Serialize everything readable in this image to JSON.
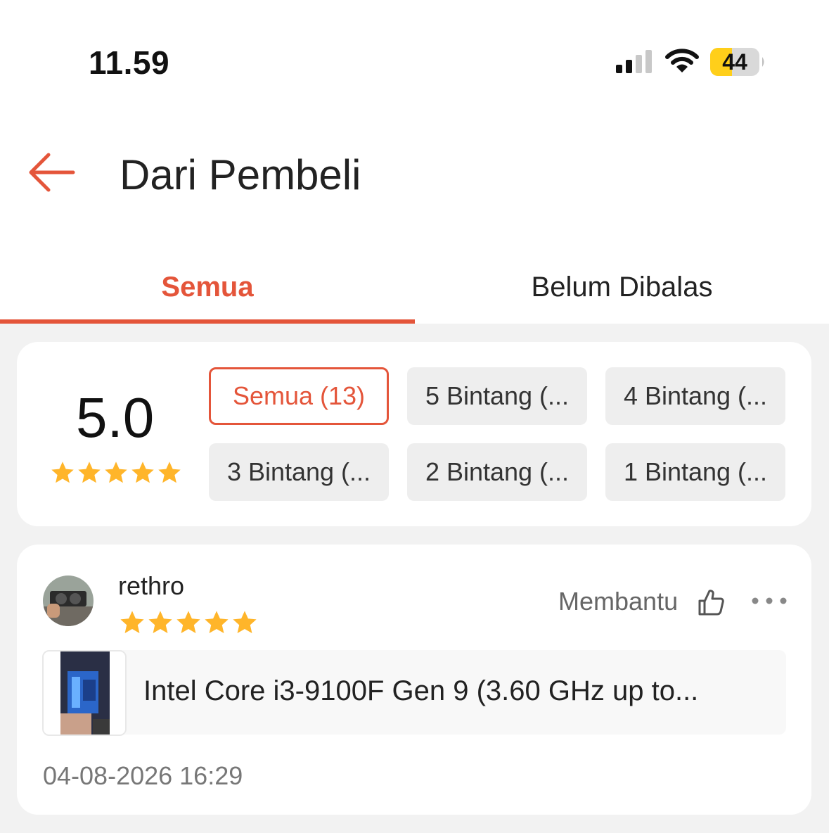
{
  "status_bar": {
    "time": "11.59",
    "battery": "44"
  },
  "header": {
    "title": "Dari Pembeli"
  },
  "tabs": [
    {
      "label": "Semua"
    },
    {
      "label": "Belum Dibalas"
    }
  ],
  "rating_summary": {
    "score": "5.0",
    "stars": 5,
    "filters": [
      {
        "label": "Semua (13)"
      },
      {
        "label": "5 Bintang (..."
      },
      {
        "label": "4 Bintang (..."
      },
      {
        "label": "3 Bintang (..."
      },
      {
        "label": "2 Bintang (..."
      },
      {
        "label": "1 Bintang (..."
      }
    ]
  },
  "review": {
    "username": "rethro",
    "stars": 5,
    "helpful_label": "Membantu",
    "product_name": "Intel Core i3-9100F Gen 9 (3.60 GHz up to...",
    "date": "04-08-2026 16:29"
  },
  "colors": {
    "accent": "#e4553a",
    "star": "#ffb52a",
    "chip_bg": "#eeeeee",
    "page_bg": "#f2f2f2"
  },
  "icons": [
    "signal-icon",
    "wifi-icon",
    "battery-icon",
    "back-arrow-icon",
    "star-icon",
    "thumbs-up-icon",
    "more-icon"
  ]
}
